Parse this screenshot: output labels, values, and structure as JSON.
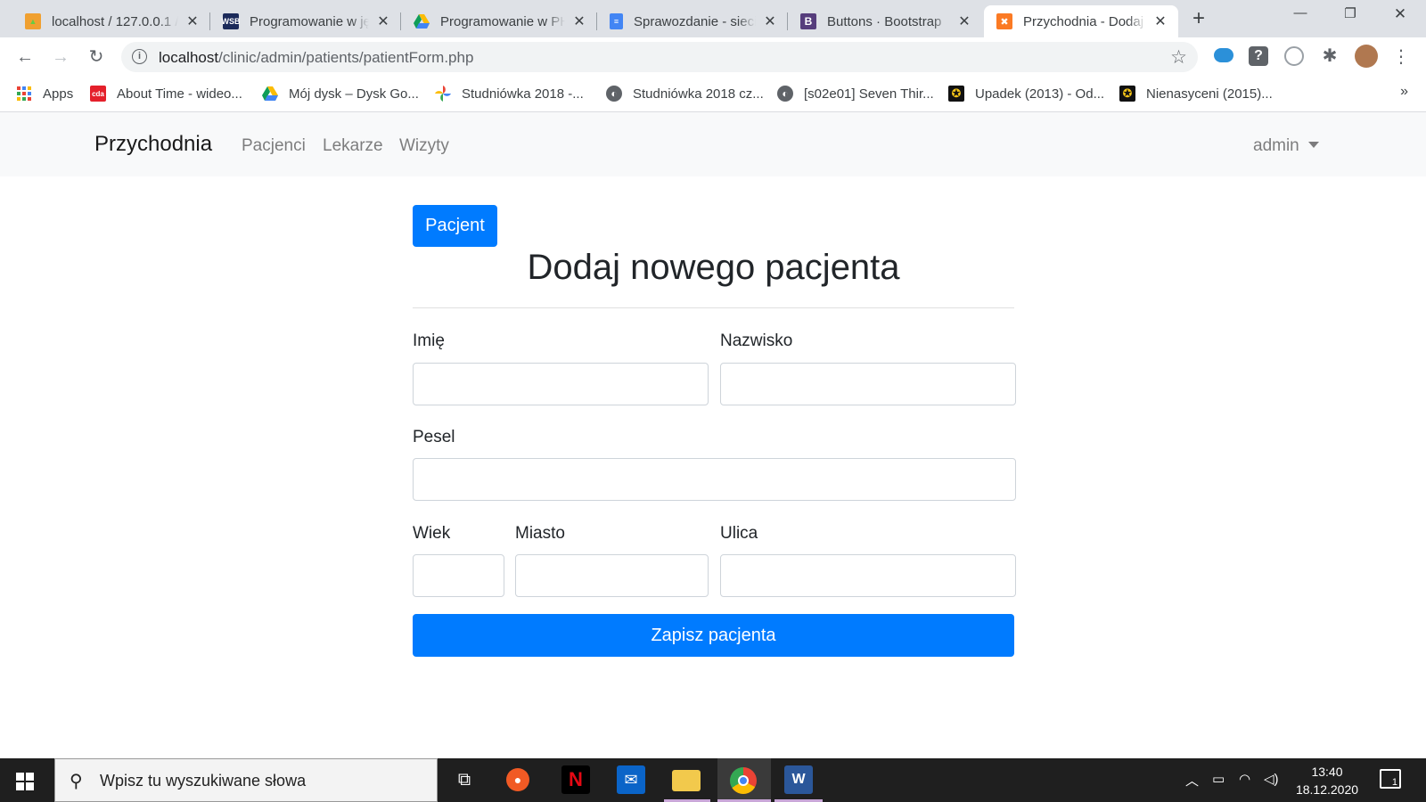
{
  "browser": {
    "tabs": [
      {
        "title": "localhost / 127.0.0.1 /",
        "favicon": "phpmyadmin-icon",
        "active": false
      },
      {
        "title": "Programowanie w języ",
        "favicon": "wsb-icon",
        "active": false
      },
      {
        "title": "Programowanie w PHP",
        "favicon": "google-drive-icon",
        "active": false
      },
      {
        "title": "Sprawozdanie - sieci",
        "favicon": "google-docs-icon",
        "active": false
      },
      {
        "title": "Buttons · Bootstrap",
        "favicon": "bootstrap-icon",
        "active": false
      },
      {
        "title": "Przychodnia - Dodaj",
        "favicon": "xampp-icon",
        "active": true
      }
    ],
    "url_host": "localhost",
    "url_path": "/clinic/admin/patients/patientForm.php",
    "bookmarks": [
      {
        "label": "Apps",
        "icon": "apps-grid-icon"
      },
      {
        "label": "About Time - wideo...",
        "icon": "cda-icon"
      },
      {
        "label": "Mój dysk – Dysk Go...",
        "icon": "google-drive-icon"
      },
      {
        "label": "Studniówka 2018 -...",
        "icon": "google-photos-icon"
      },
      {
        "label": "Studniówka 2018 cz...",
        "icon": "globe-icon"
      },
      {
        "label": "[s02e01] Seven Thir...",
        "icon": "globe-icon"
      },
      {
        "label": "Upadek (2013) - Od...",
        "icon": "film-reel-icon"
      },
      {
        "label": "Nienasyceni (2015)...",
        "icon": "film-reel-icon"
      }
    ],
    "bookmarks_more": "»"
  },
  "app": {
    "brand": "Przychodnia",
    "nav": [
      "Pacjenci",
      "Lekarze",
      "Wizyty"
    ],
    "user": "admin"
  },
  "form": {
    "badge_button": "Pacjent",
    "title": "Dodaj nowego pacjenta",
    "labels": {
      "imie": "Imię",
      "nazwisko": "Nazwisko",
      "pesel": "Pesel",
      "wiek": "Wiek",
      "miasto": "Miasto",
      "ulica": "Ulica"
    },
    "values": {
      "imie": "",
      "nazwisko": "",
      "pesel": "",
      "wiek": "",
      "miasto": "",
      "ulica": ""
    },
    "submit": "Zapisz pacjenta"
  },
  "taskbar": {
    "search_placeholder": "Wpisz tu wyszukiwane słowa",
    "time": "13:40",
    "date": "18.12.2020",
    "notifications": "1"
  },
  "colors": {
    "primary": "#007bff",
    "navbar_bg": "#f8f9fa",
    "tabstrip_bg": "#dee1e6",
    "taskbar_bg": "#1f1f1f"
  }
}
